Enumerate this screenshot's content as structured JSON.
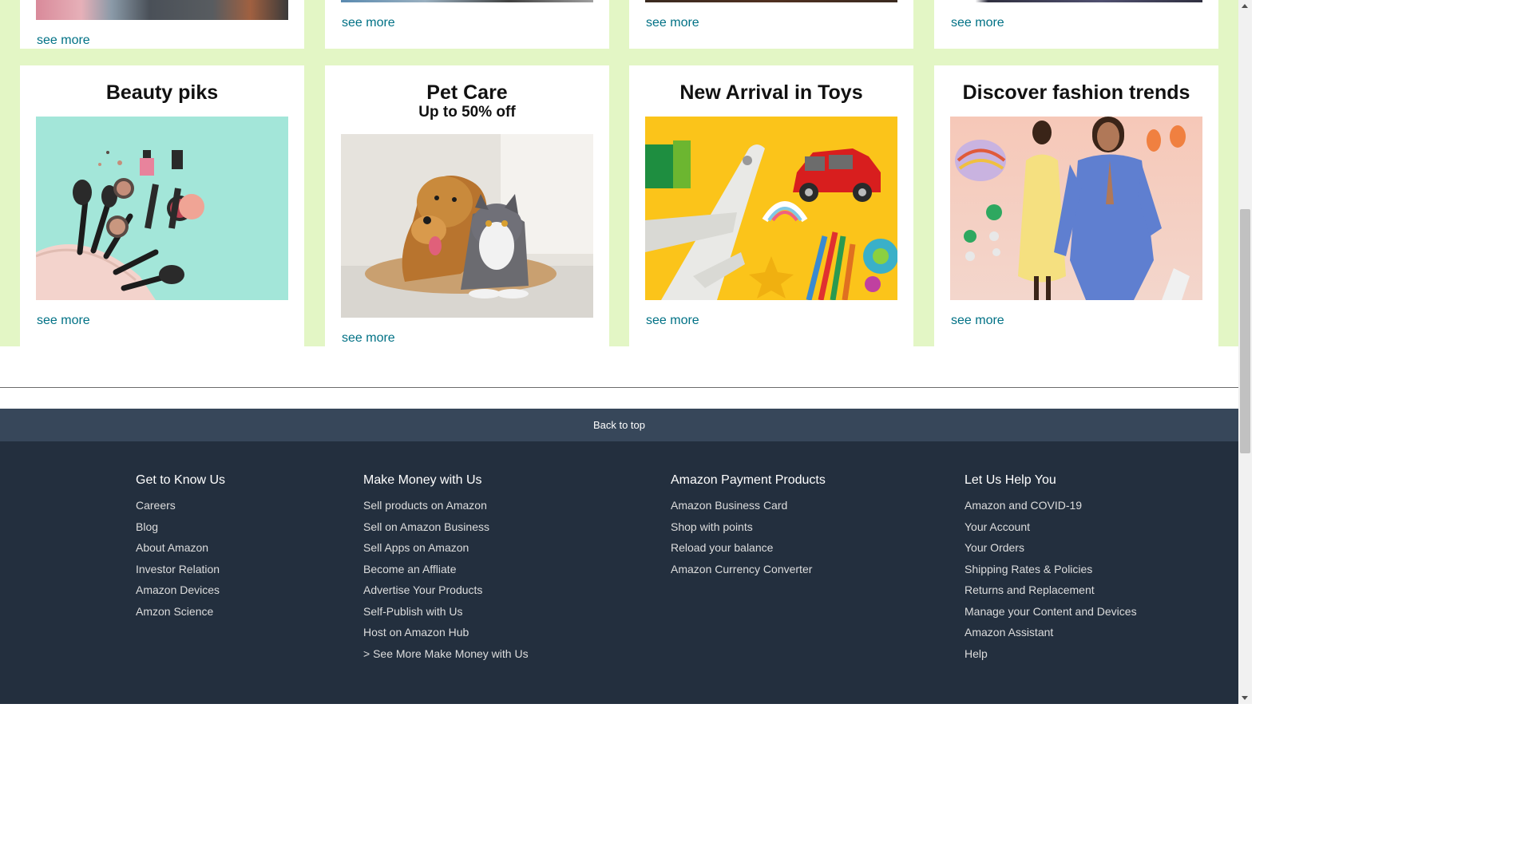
{
  "top_row": [
    {
      "see_more": "see more"
    },
    {
      "see_more": "see more"
    },
    {
      "see_more": "see more"
    },
    {
      "see_more": "see more"
    }
  ],
  "cards": [
    {
      "title": "Beauty piks",
      "subtitle": "",
      "see_more": "see more",
      "image": "makeup-products"
    },
    {
      "title": "Pet Care",
      "subtitle": "Up to 50% off",
      "see_more": "see more",
      "image": "dog-and-cat"
    },
    {
      "title": "New Arrival in Toys",
      "subtitle": "",
      "see_more": "see more",
      "image": "toy-plane-and-car"
    },
    {
      "title": "Discover fashion trends",
      "subtitle": "",
      "see_more": "see more",
      "image": "fashion-models"
    }
  ],
  "back_to_top": "Back to top",
  "footer": {
    "columns": [
      {
        "heading": "Get to Know Us",
        "links": [
          "Careers",
          "Blog",
          "About Amazon",
          "Investor Relation",
          "Amazon Devices",
          "Amzon Science"
        ]
      },
      {
        "heading": "Make Money with Us",
        "links": [
          "Sell products on Amazon",
          "Sell on Amazon Business",
          "Sell Apps on Amazon",
          "Become an Affliate",
          "Advertise Your Products",
          "Self-Publish with Us",
          "Host on Amazon Hub",
          "> See More Make Money with Us"
        ]
      },
      {
        "heading": "Amazon Payment Products",
        "links": [
          "Amazon Business Card",
          "Shop with points",
          "Reload your balance",
          "Amazon Currency Converter"
        ]
      },
      {
        "heading": "Let Us Help You",
        "links": [
          "Amazon and COVID-19",
          "Your Account",
          "Your Orders",
          "Shipping Rates & Policies",
          "Returns and Replacement",
          "Manage your Content and Devices",
          "Amazon Assistant",
          "Help"
        ]
      }
    ]
  },
  "colors": {
    "page_bg": "#e3f6c5",
    "link": "#007185",
    "back_to_top": "#37475a",
    "footer": "#232f3e"
  }
}
